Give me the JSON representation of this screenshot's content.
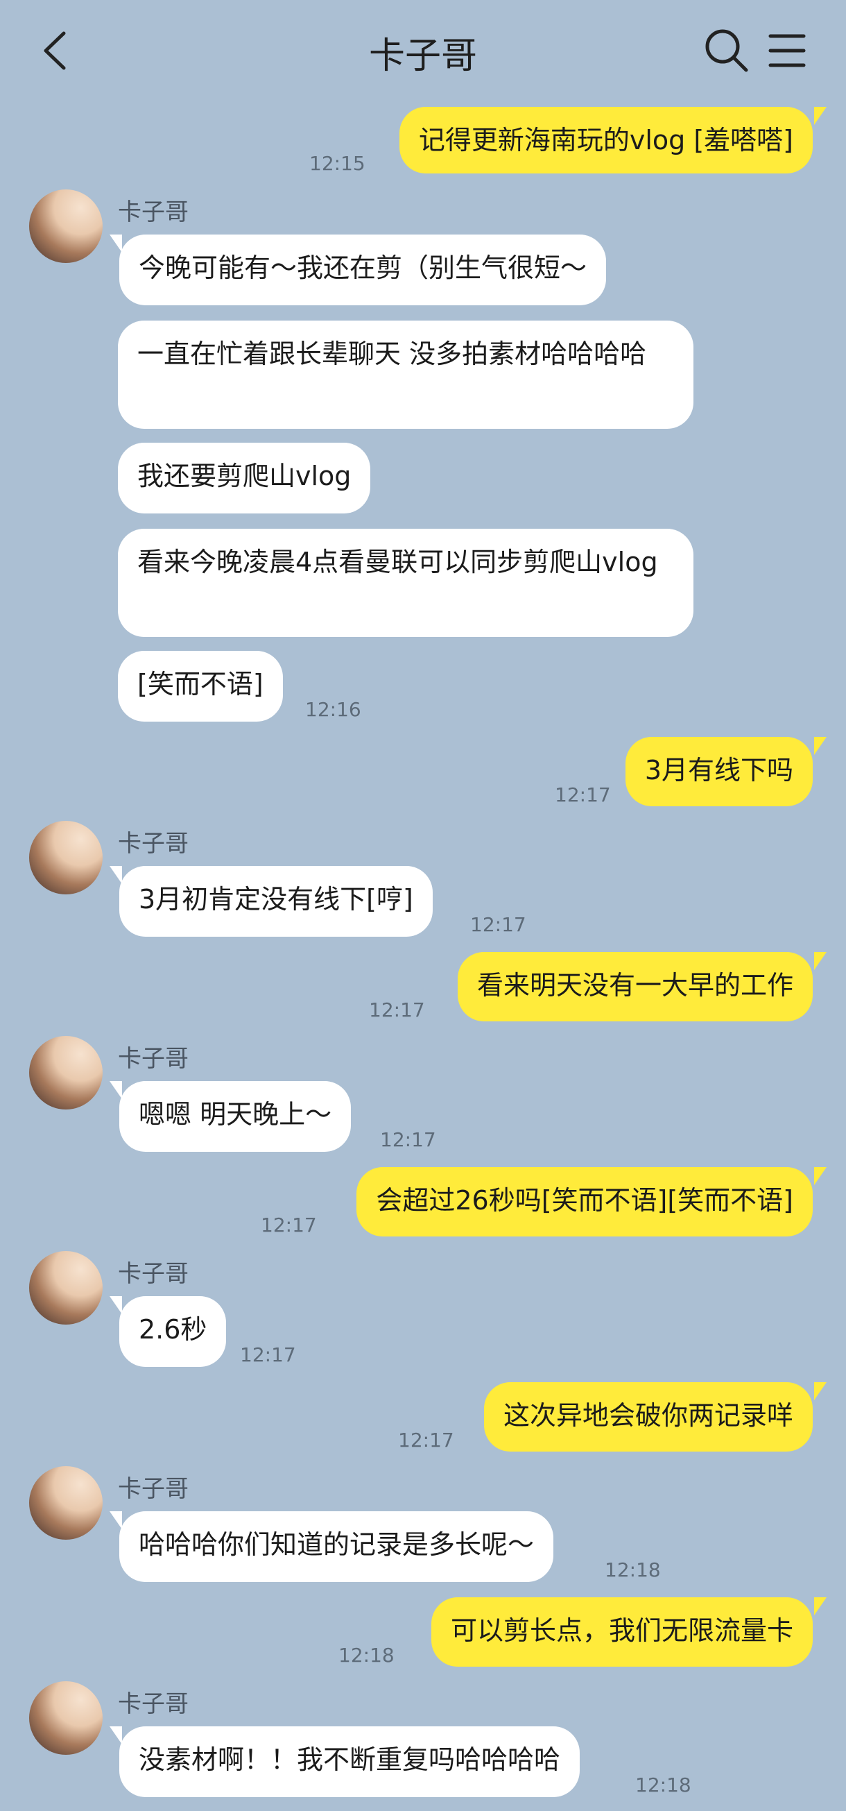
{
  "header": {
    "title": "卡子哥",
    "back_icon": "chevron-left-icon",
    "search_icon": "search-icon",
    "menu_icon": "hamburger-menu-icon"
  },
  "contact": {
    "name": "卡子哥"
  },
  "colors": {
    "background": "#abbfd3",
    "outgoing_bubble": "#ffeb3b",
    "incoming_bubble": "#ffffff",
    "time_text": "#5d6b79"
  },
  "messages": [
    {
      "dir": "out",
      "text": "记得更新海南玩的vlog [羞嗒嗒]",
      "time": "12:15"
    },
    {
      "dir": "in",
      "text": "今晚可能有～我还在剪（别生气很短～"
    },
    {
      "dir": "in",
      "text": "一直在忙着跟长辈聊天 没多拍素材哈哈哈哈"
    },
    {
      "dir": "in",
      "text": "我还要剪爬山vlog"
    },
    {
      "dir": "in",
      "text": "看来今晚凌晨4点看曼联可以同步剪爬山vlog"
    },
    {
      "dir": "in",
      "text": "[笑而不语]",
      "time": "12:16"
    },
    {
      "dir": "out",
      "text": "3月有线下吗",
      "time": "12:17"
    },
    {
      "dir": "in",
      "text": "3月初肯定没有线下[哼]",
      "time": "12:17"
    },
    {
      "dir": "out",
      "text": "看来明天没有一大早的工作",
      "time": "12:17"
    },
    {
      "dir": "in",
      "text": "嗯嗯 明天晚上～",
      "time": "12:17"
    },
    {
      "dir": "out",
      "text": "会超过26秒吗[笑而不语][笑而不语]",
      "time": "12:17"
    },
    {
      "dir": "in",
      "text": "2.6秒",
      "time": "12:17"
    },
    {
      "dir": "out",
      "text": "这次异地会破你两记录咩",
      "time": "12:17"
    },
    {
      "dir": "in",
      "text": "哈哈哈你们知道的记录是多长呢～",
      "time": "12:18"
    },
    {
      "dir": "out",
      "text": "可以剪长点，我们无限流量卡",
      "time": "12:18"
    },
    {
      "dir": "in",
      "text": "没素材啊！！我不断重复吗哈哈哈哈",
      "time": "12:18"
    }
  ]
}
